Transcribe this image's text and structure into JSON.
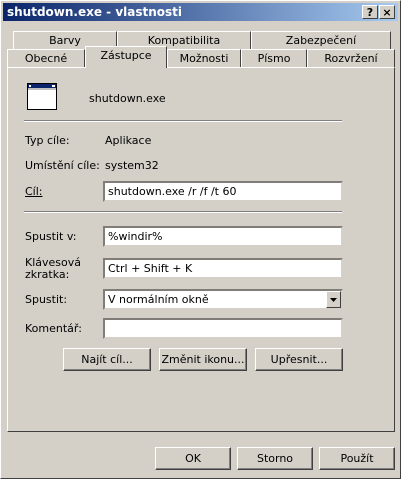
{
  "window": {
    "title": "shutdown.exe - vlastnosti",
    "help_button": "?",
    "close_button": "×"
  },
  "tabs_row1": [
    {
      "label": "Barvy"
    },
    {
      "label": "Kompatibilita"
    },
    {
      "label": "Zabezpečení"
    }
  ],
  "tabs_row2": [
    {
      "label": "Obecné"
    },
    {
      "label": "Zástupce",
      "active": true
    },
    {
      "label": "Možnosti"
    },
    {
      "label": "Písmo"
    },
    {
      "label": "Rozvržení"
    }
  ],
  "shortcut": {
    "name": "shutdown.exe",
    "target_type_label": "Typ cíle:",
    "target_type_value": "Aplikace",
    "target_location_label": "Umístění cíle:",
    "target_location_value": "system32",
    "target_label": "Cíl:",
    "target_value": "shutdown.exe /r /f /t 60",
    "start_in_label": "Spustit v:",
    "start_in_value": "%windir%",
    "hotkey_label_line1": "Klávesová",
    "hotkey_label_line2": "zkratka:",
    "hotkey_value": "Ctrl + Shift + K",
    "run_label": "Spustit:",
    "run_value": "V normálním okně",
    "comment_label": "Komentář:",
    "comment_value": ""
  },
  "buttons": {
    "find_target": "Najít cíl...",
    "change_icon": "Změnit ikonu...",
    "advanced": "Upřesnit...",
    "ok": "OK",
    "cancel": "Storno",
    "apply": "Použít"
  },
  "colors": {
    "title_start": "#0a246a",
    "title_end": "#a6caf0",
    "face": "#d4d0c8"
  }
}
